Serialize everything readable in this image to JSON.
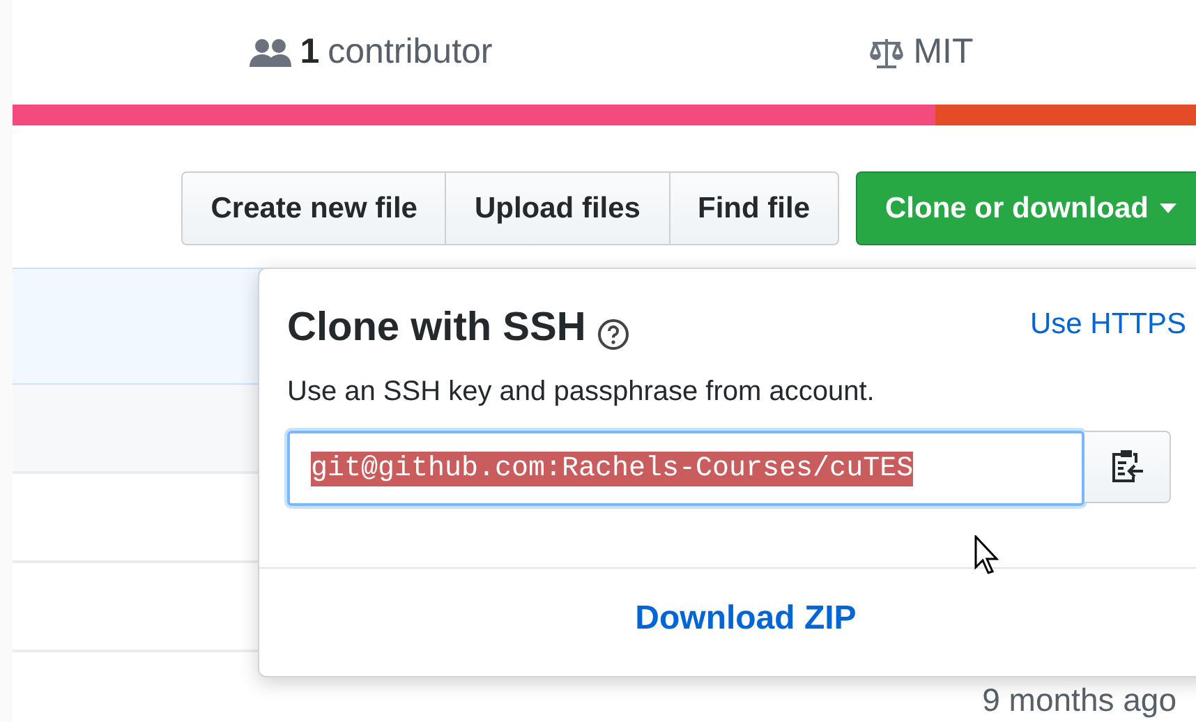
{
  "stats": [
    {
      "kind": "contributors",
      "count": "1",
      "label": "contributor"
    },
    {
      "kind": "license",
      "label": "MIT"
    }
  ],
  "languages": [
    {
      "color": "#f34b7d",
      "level": 0.78
    },
    {
      "color": "#e34c26",
      "level": 0.22
    }
  ],
  "buttons": [
    {
      "label": "Create new file"
    },
    {
      "label": "Upload files"
    },
    {
      "label": "Find file"
    }
  ],
  "clone_button": {
    "label": "Clone or download",
    "expanded": true
  },
  "popover": {
    "title": "Clone with SSH",
    "switch_link": "Use HTTPS",
    "description": "Use an SSH key and passphrase from account.",
    "field": {
      "value": "git@github.com:Rachels-Courses/cuTES",
      "selected": true
    },
    "download": "Download ZIP"
  },
  "last_row": {
    "age": "9 months ago"
  }
}
